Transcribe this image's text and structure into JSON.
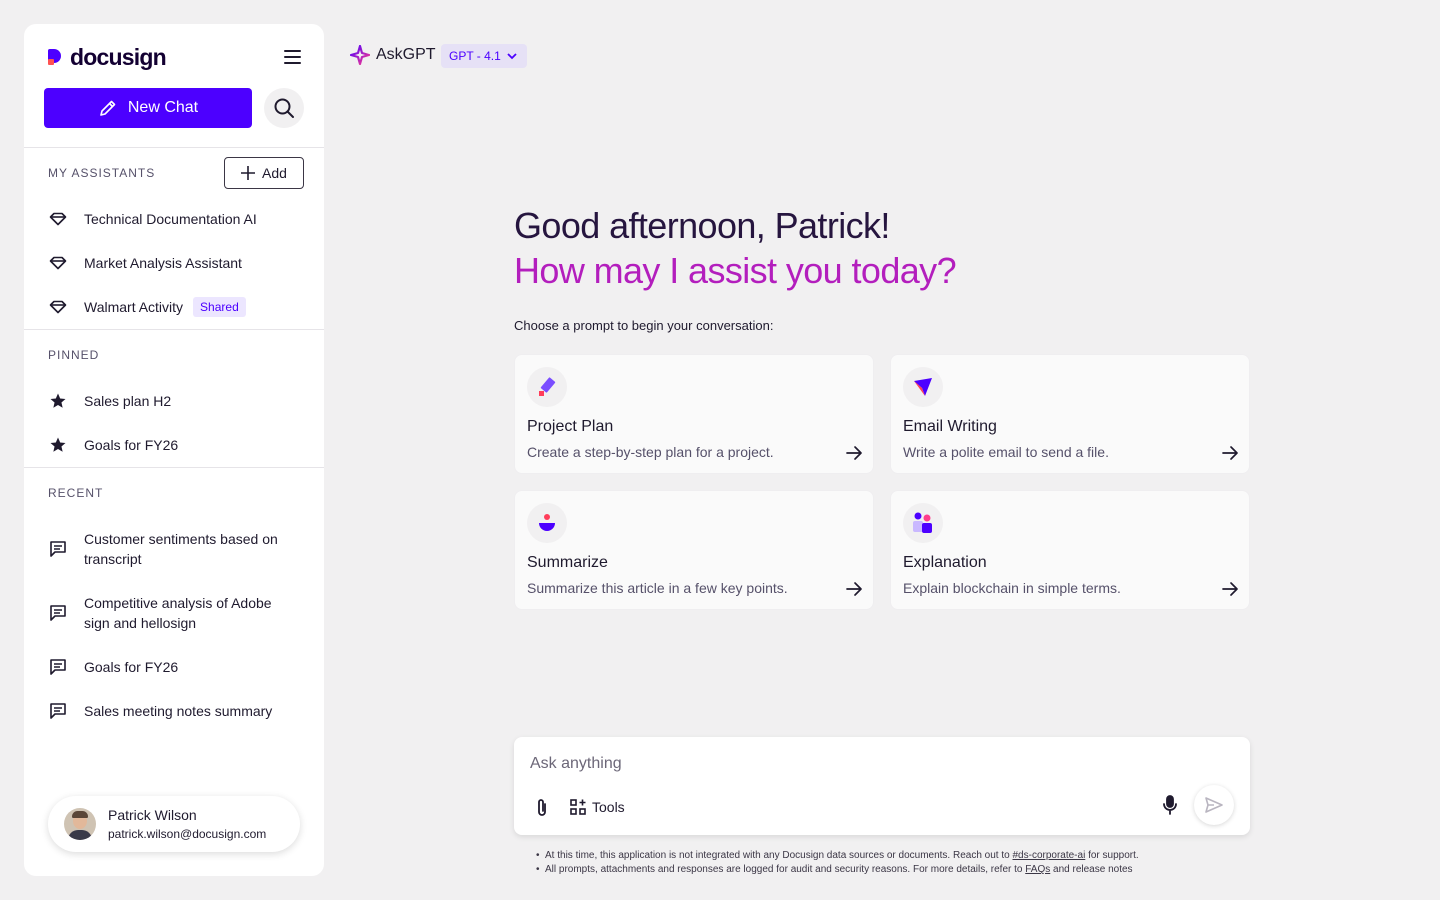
{
  "sidebar": {
    "logo_text": "docusign",
    "new_chat_label": "New Chat",
    "my_assistants_label": "MY ASSISTANTS",
    "add_label": "Add",
    "assistants": [
      {
        "label": "Technical Documentation AI",
        "icon": "gem-icon"
      },
      {
        "label": "Market Analysis Assistant",
        "icon": "gem-icon"
      },
      {
        "label": "Walmart Activity",
        "icon": "gem-icon",
        "badge": "Shared"
      }
    ],
    "pinned_label": "PINNED",
    "pinned": [
      {
        "label": "Sales plan H2",
        "icon": "star-icon"
      },
      {
        "label": "Goals for FY26",
        "icon": "star-icon"
      }
    ],
    "recent_label": "RECENT",
    "recent": [
      {
        "line1": "Customer sentiments based on",
        "line2": "transcript",
        "icon": "chat-icon"
      },
      {
        "line1": "Competitive analysis of Adobe",
        "line2": "sign and hellosign",
        "icon": "chat-icon"
      },
      {
        "line1": "Goals for FY26",
        "icon": "chat-icon"
      },
      {
        "line1": "Sales meeting notes summary",
        "icon": "chat-icon"
      }
    ],
    "user": {
      "name": "Patrick Wilson",
      "email": "patrick.wilson@docusign.com"
    }
  },
  "header": {
    "app_name": "AskGPT",
    "model": "GPT - 4.1"
  },
  "main": {
    "greeting": "Good afternoon, Patrick!",
    "subgreeting": "How may I assist you today?",
    "choose_prompt": "Choose a prompt to begin your conversation:",
    "cards": [
      {
        "title": "Project Plan",
        "desc": "Create a step-by-step plan for a project.",
        "icon": "pen-icon"
      },
      {
        "title": "Email Writing",
        "desc": "Write a polite email to send a file.",
        "icon": "paper-plane-icon"
      },
      {
        "title": "Summarize",
        "desc": "Summarize this article in a few key points.",
        "icon": "summary-icon"
      },
      {
        "title": "Explanation",
        "desc": "Explain blockchain in simple terms.",
        "icon": "people-icon"
      }
    ]
  },
  "composer": {
    "placeholder": "Ask anything",
    "tools_label": "Tools"
  },
  "footnotes": {
    "note1_pre": "At this time, this application is not integrated with any Docusign data sources or documents. Reach out to ",
    "note1_link": "#ds-corporate-ai",
    "note1_post": " for support.",
    "note2_pre": "All prompts, attachments and responses are logged for audit and security reasons. For more details, refer to ",
    "note2_link": "FAQs",
    "note2_post": " and release notes"
  },
  "colors": {
    "accent": "#4c00ff",
    "greeting_accent": "#b31ebd",
    "background": "#f1f0f1"
  }
}
